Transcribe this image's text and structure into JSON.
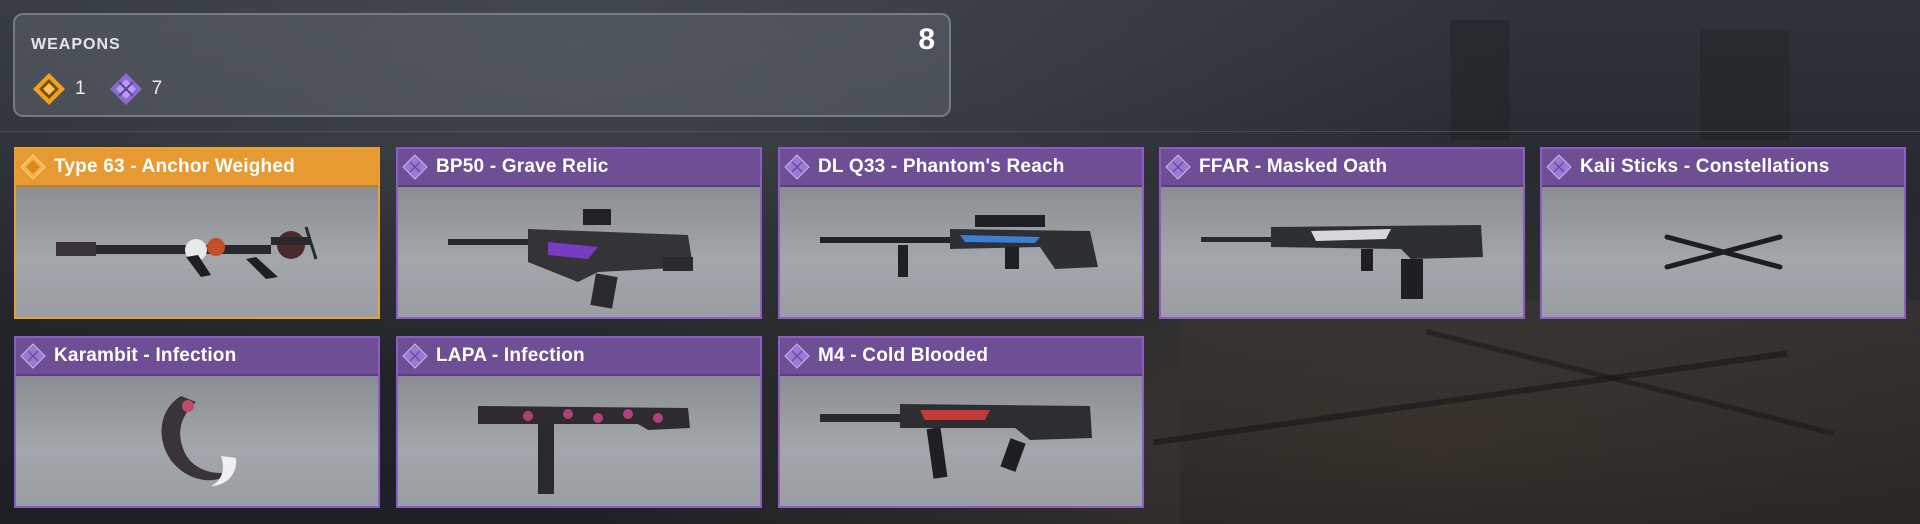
{
  "summary": {
    "title": "WEAPONS",
    "total": "8",
    "rarities": [
      {
        "icon": "legendary-rarity-icon",
        "count": "1",
        "color": "#f0a21c"
      },
      {
        "icon": "epic-rarity-icon",
        "count": "7",
        "color": "#9f7ee0"
      }
    ]
  },
  "colors": {
    "legendary": "#e89a32",
    "epic": "#6e4f96"
  },
  "weapons": [
    {
      "name": "Type 63 - Anchor Weighed",
      "rarity": "legendary",
      "icon": "rifle-weapon-icon"
    },
    {
      "name": "BP50 - Grave Relic",
      "rarity": "epic",
      "icon": "bullpup-rifle-weapon-icon"
    },
    {
      "name": "DL Q33 - Phantom's Reach",
      "rarity": "epic",
      "icon": "sniper-rifle-weapon-icon"
    },
    {
      "name": "FFAR - Masked Oath",
      "rarity": "epic",
      "icon": "assault-rifle-weapon-icon"
    },
    {
      "name": "Kali Sticks - Constellations",
      "rarity": "epic",
      "icon": "kali-sticks-weapon-icon"
    },
    {
      "name": "Karambit - Infection",
      "rarity": "epic",
      "icon": "karambit-knife-icon"
    },
    {
      "name": "LAPA - Infection",
      "rarity": "epic",
      "icon": "smg-weapon-icon"
    },
    {
      "name": "M4 - Cold Blooded",
      "rarity": "epic",
      "icon": "m4-rifle-weapon-icon"
    }
  ]
}
